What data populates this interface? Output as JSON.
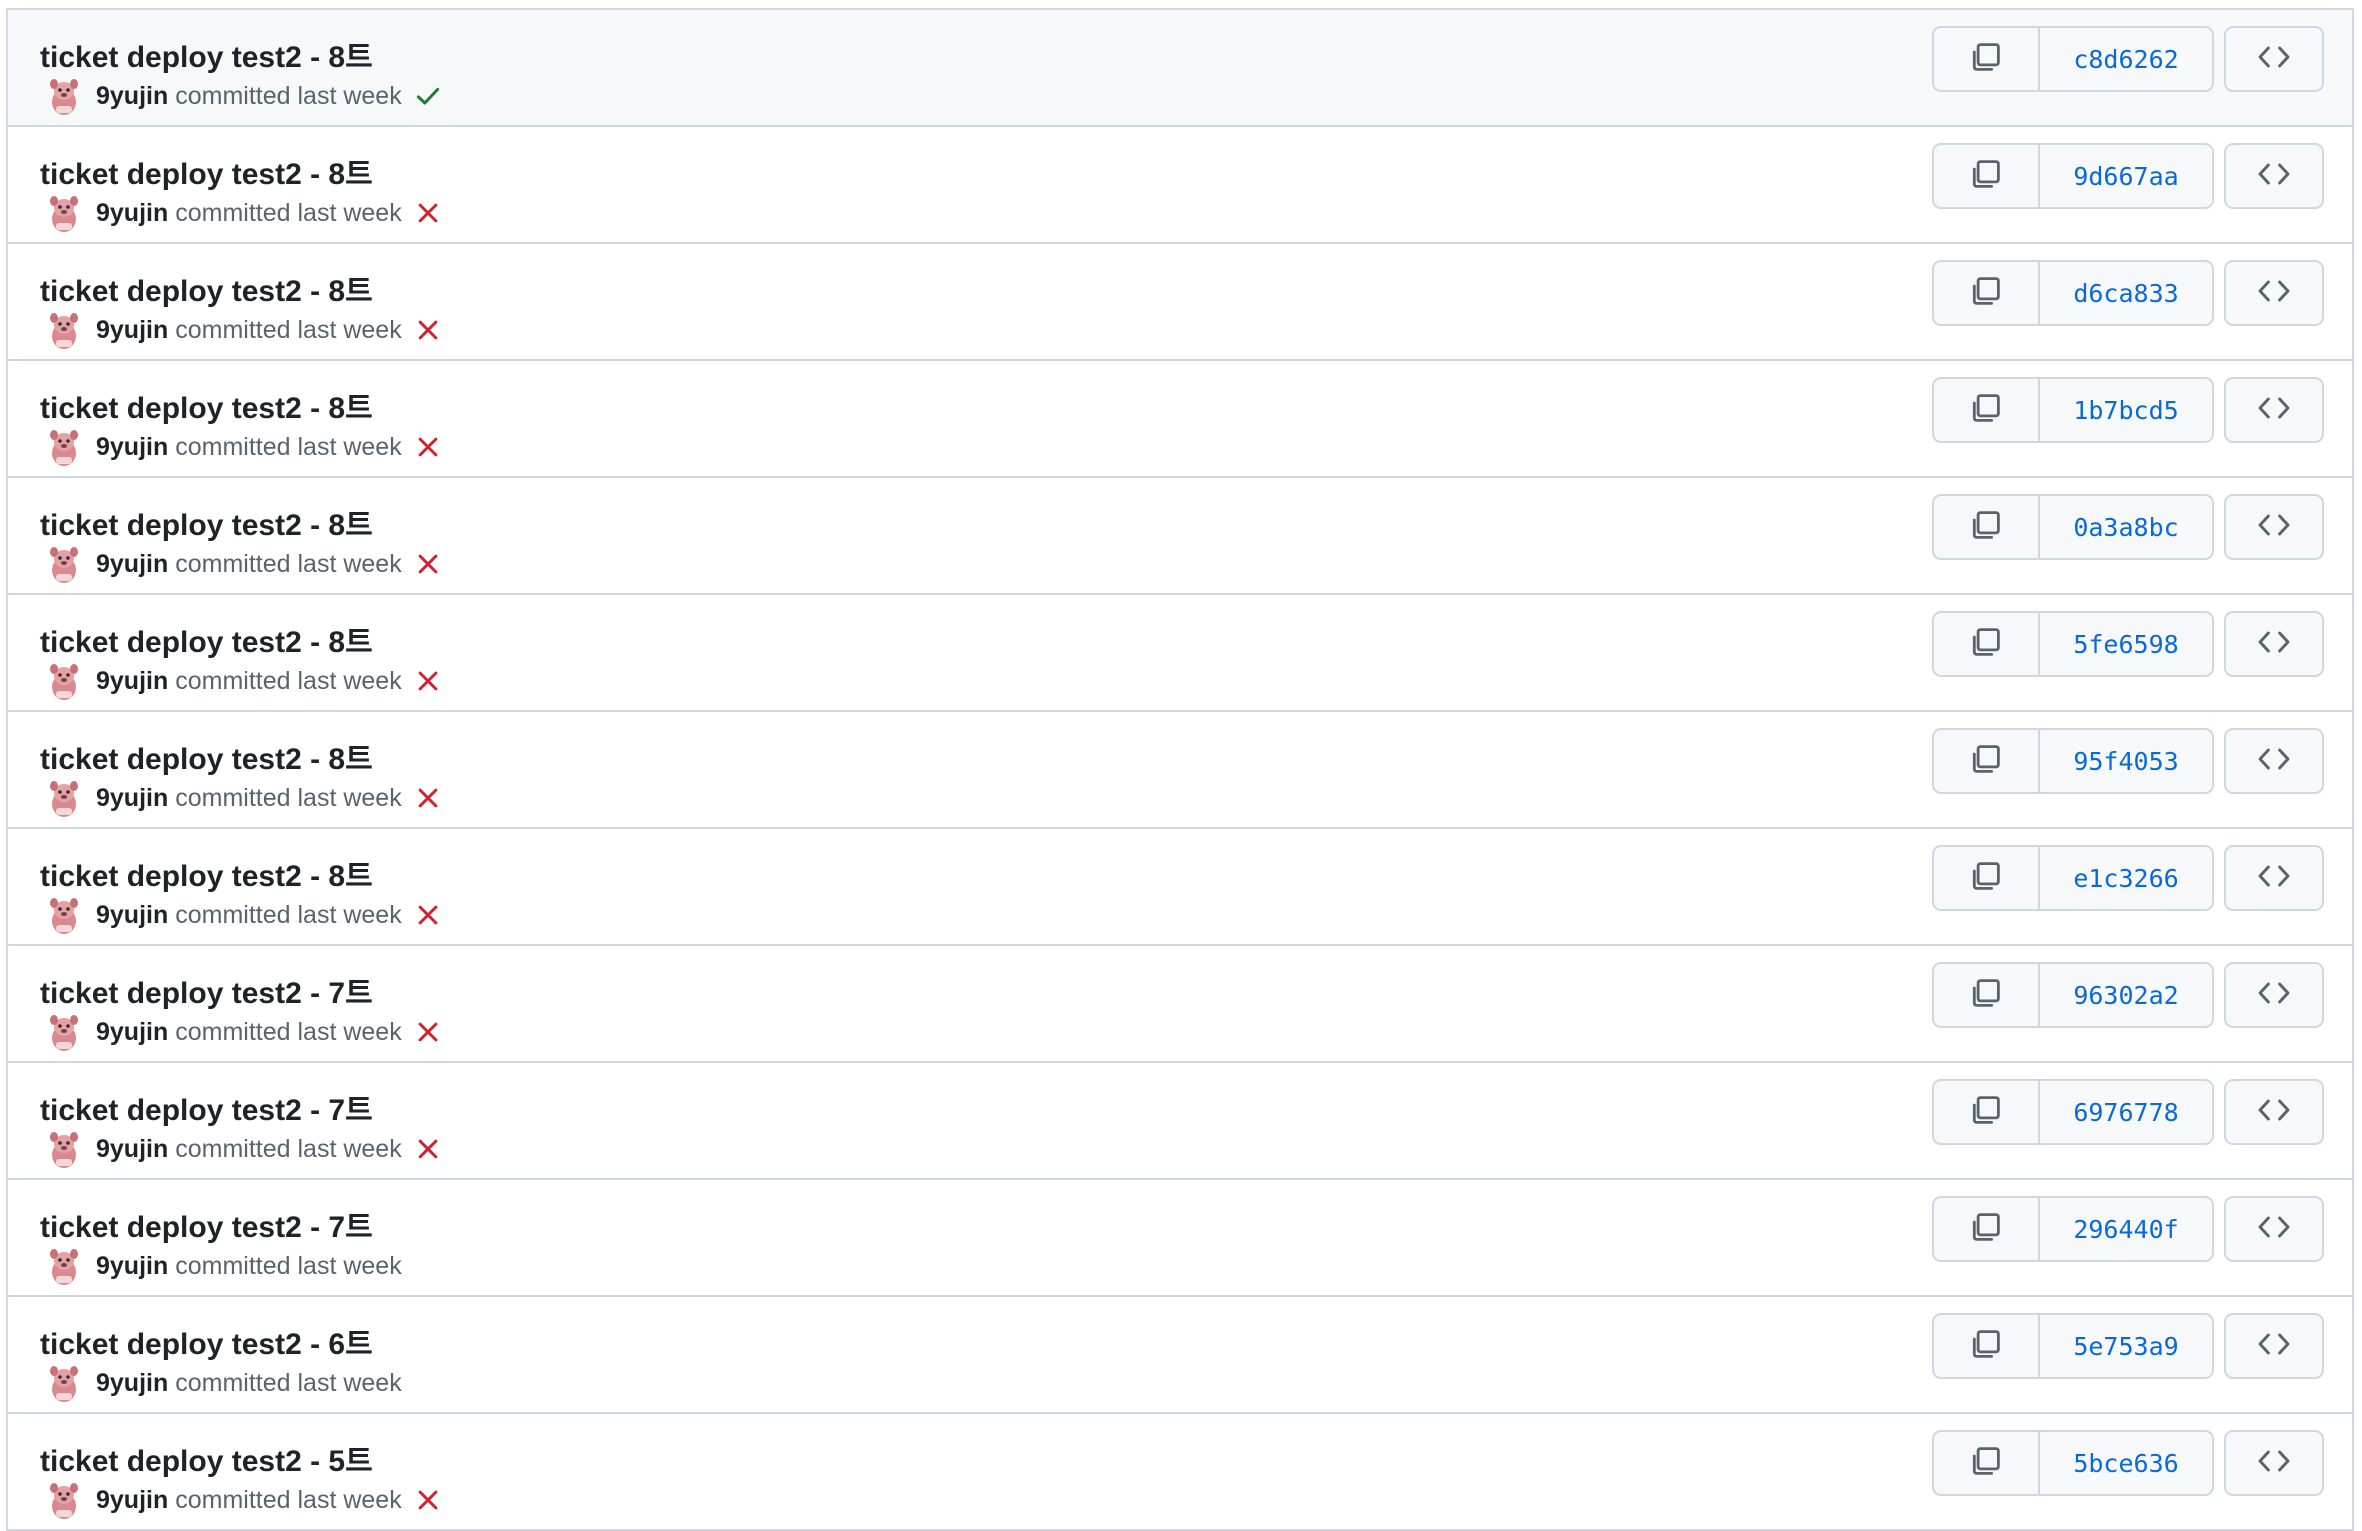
{
  "commits": [
    {
      "title": "ticket deploy test2 - 8트",
      "author": "9yujin",
      "time_text": "committed last week",
      "status": "success",
      "sha": "c8d6262"
    },
    {
      "title": "ticket deploy test2 - 8트",
      "author": "9yujin",
      "time_text": "committed last week",
      "status": "failure",
      "sha": "9d667aa"
    },
    {
      "title": "ticket deploy test2 - 8트",
      "author": "9yujin",
      "time_text": "committed last week",
      "status": "failure",
      "sha": "d6ca833"
    },
    {
      "title": "ticket deploy test2 - 8트",
      "author": "9yujin",
      "time_text": "committed last week",
      "status": "failure",
      "sha": "1b7bcd5"
    },
    {
      "title": "ticket deploy test2 - 8트",
      "author": "9yujin",
      "time_text": "committed last week",
      "status": "failure",
      "sha": "0a3a8bc"
    },
    {
      "title": "ticket deploy test2 - 8트",
      "author": "9yujin",
      "time_text": "committed last week",
      "status": "failure",
      "sha": "5fe6598"
    },
    {
      "title": "ticket deploy test2 - 8트",
      "author": "9yujin",
      "time_text": "committed last week",
      "status": "failure",
      "sha": "95f4053"
    },
    {
      "title": "ticket deploy test2 - 8트",
      "author": "9yujin",
      "time_text": "committed last week",
      "status": "failure",
      "sha": "e1c3266"
    },
    {
      "title": "ticket deploy test2 - 7트",
      "author": "9yujin",
      "time_text": "committed last week",
      "status": "failure",
      "sha": "96302a2"
    },
    {
      "title": "ticket deploy test2 - 7트",
      "author": "9yujin",
      "time_text": "committed last week",
      "status": "failure",
      "sha": "6976778"
    },
    {
      "title": "ticket deploy test2 - 7트",
      "author": "9yujin",
      "time_text": "committed last week",
      "status": "none",
      "sha": "296440f"
    },
    {
      "title": "ticket deploy test2 - 6트",
      "author": "9yujin",
      "time_text": "committed last week",
      "status": "none",
      "sha": "5e753a9"
    },
    {
      "title": "ticket deploy test2 - 5트",
      "author": "9yujin",
      "time_text": "committed last week",
      "status": "failure",
      "sha": "5bce636"
    }
  ],
  "icons": {
    "copy": "copy-icon",
    "browse": "code-icon",
    "success": "check-icon",
    "failure": "x-icon"
  },
  "colors": {
    "success": "#1a7f37",
    "failure": "#cf222e",
    "sha_link": "#0969da",
    "highlight_row": "#f6f8fa"
  }
}
